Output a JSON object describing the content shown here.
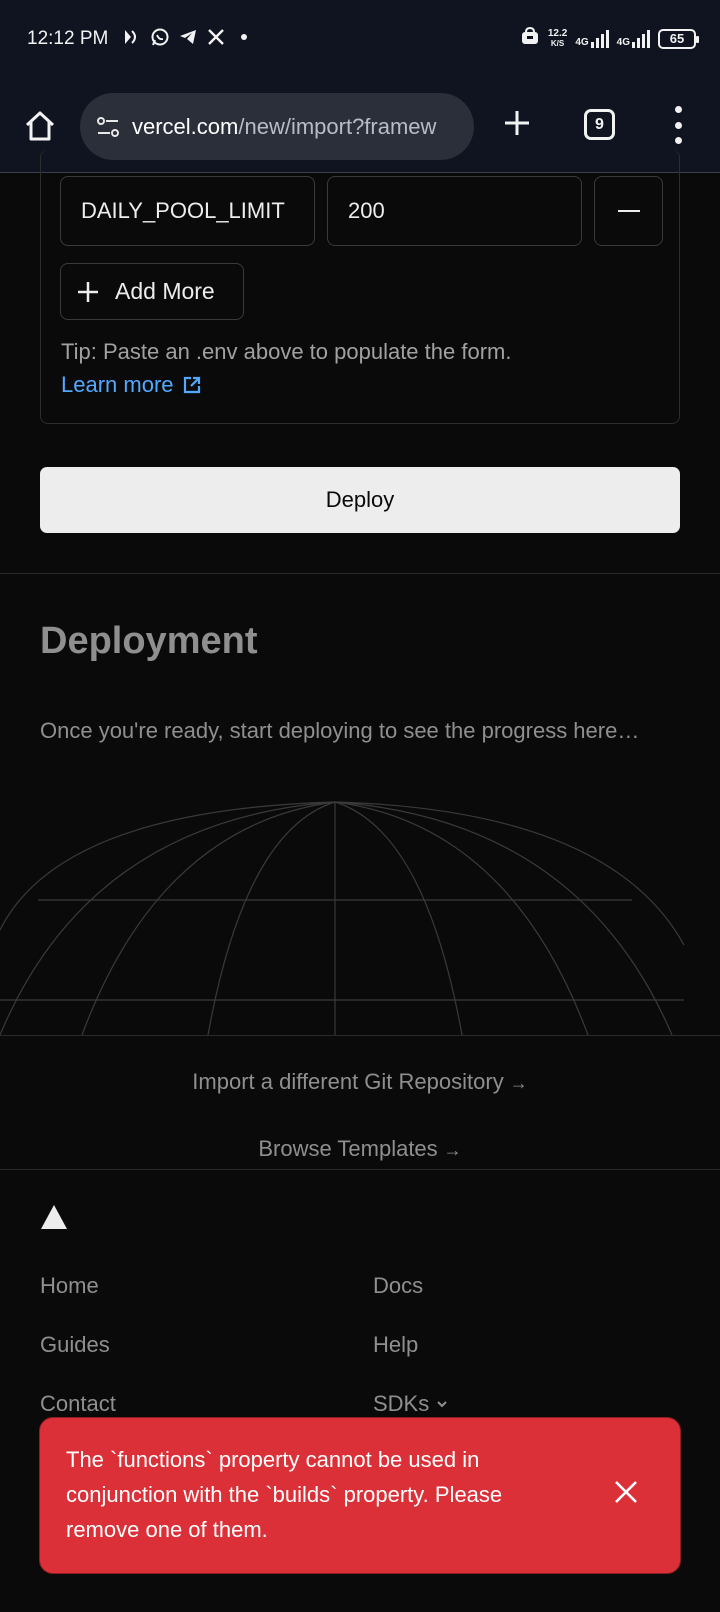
{
  "status_bar": {
    "time": "12:12 PM",
    "net_speed_value": "12.2",
    "net_speed_unit": "K/S",
    "sim1": "4G",
    "sim2": "4G",
    "battery": "65"
  },
  "browser": {
    "url_host": "vercel.com",
    "url_path": "/new/import?framew",
    "tab_count": "9"
  },
  "env_vars": {
    "key": "DAILY_POOL_LIMIT",
    "value": "200",
    "add_more_label": "Add More",
    "tip": "Tip: Paste an .env above to populate the form.",
    "learn_more": "Learn more"
  },
  "deploy_button_label": "Deploy",
  "deployment": {
    "title": "Deployment",
    "description": "Once you're ready, start deploying to see the progress here…"
  },
  "links": {
    "import_repo": "Import a different Git Repository",
    "browse_templates": "Browse Templates",
    "arrow": "→"
  },
  "footer": {
    "items": [
      "Home",
      "Docs",
      "Guides",
      "Help",
      "Contact",
      "SDKs"
    ]
  },
  "toast": {
    "message": "The `functions` property cannot be used in conjunction with the `builds` property. Please remove one of them."
  },
  "colors": {
    "background": "#0a0a0a",
    "toast": "#dc3038",
    "link": "#52a8ff",
    "deploy_button": "#ededed"
  }
}
